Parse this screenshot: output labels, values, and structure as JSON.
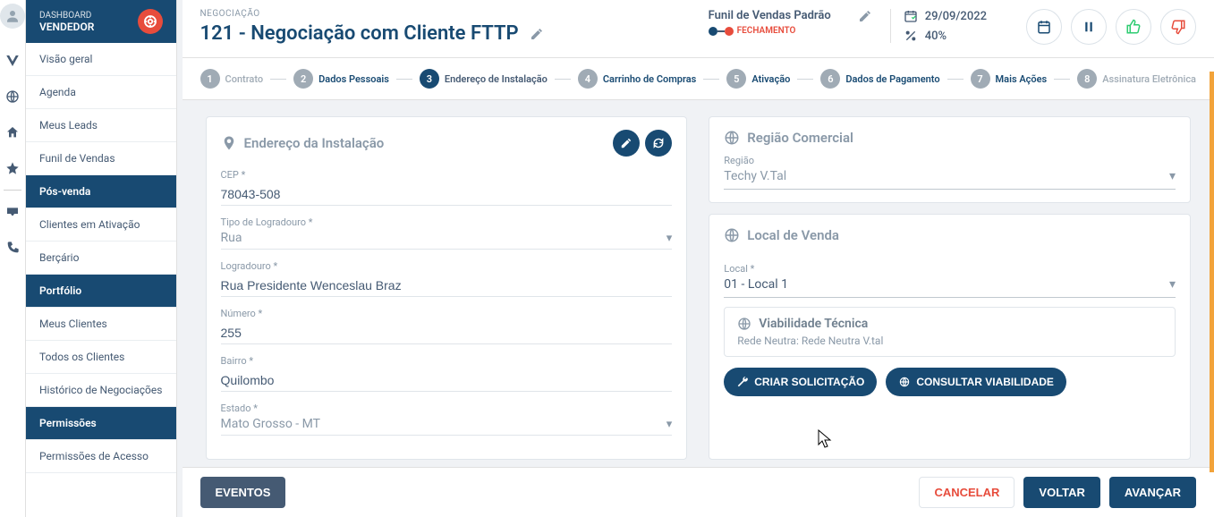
{
  "sidebar": {
    "dashboard_label": "DASHBOARD",
    "role": "VENDEDOR",
    "items": [
      {
        "label": "Visão geral",
        "type": "item"
      },
      {
        "label": "Agenda",
        "type": "item"
      },
      {
        "label": "Meus Leads",
        "type": "item"
      },
      {
        "label": "Funil de Vendas",
        "type": "item"
      },
      {
        "label": "Pós-venda",
        "type": "section"
      },
      {
        "label": "Clientes em Ativação",
        "type": "item"
      },
      {
        "label": "Berçário",
        "type": "item"
      },
      {
        "label": "Portfólio",
        "type": "section"
      },
      {
        "label": "Meus Clientes",
        "type": "item"
      },
      {
        "label": "Todos os Clientes",
        "type": "item"
      },
      {
        "label": "Histórico de Negociações",
        "type": "item"
      },
      {
        "label": "Permissões",
        "type": "section"
      },
      {
        "label": "Permissões de Acesso",
        "type": "item"
      }
    ]
  },
  "header": {
    "breadcrumb": "NEGOCIAÇÃO",
    "title": "121 - Negociação com Cliente FTTP",
    "funnel_title": "Funil de Vendas Padrão",
    "funnel_stage": "FECHAMENTO",
    "date": "29/09/2022",
    "percent": "40%"
  },
  "steps": [
    {
      "num": "1",
      "label": "Contrato",
      "state": "past"
    },
    {
      "num": "2",
      "label": "Dados Pessoais",
      "state": "link"
    },
    {
      "num": "3",
      "label": "Endereço de Instalação",
      "state": "active"
    },
    {
      "num": "4",
      "label": "Carrinho de Compras",
      "state": "link"
    },
    {
      "num": "5",
      "label": "Ativação",
      "state": "link"
    },
    {
      "num": "6",
      "label": "Dados de Pagamento",
      "state": "link"
    },
    {
      "num": "7",
      "label": "Mais Ações",
      "state": "link"
    },
    {
      "num": "8",
      "label": "Assinatura Eletrônica",
      "state": "past"
    }
  ],
  "install": {
    "card_title": "Endereço da Instalação",
    "fields": {
      "cep_label": "CEP *",
      "cep_value": "78043-508",
      "tipo_label": "Tipo de Logradouro *",
      "tipo_value": "Rua",
      "logradouro_label": "Logradouro *",
      "logradouro_value": "Rua Presidente Wenceslau Braz",
      "numero_label": "Número *",
      "numero_value": "255",
      "bairro_label": "Bairro *",
      "bairro_value": "Quilombo",
      "estado_label": "Estado *",
      "estado_value": "Mato Grosso - MT"
    }
  },
  "right": {
    "regiao_title": "Região Comercial",
    "regiao_label": "Região",
    "regiao_value": "Techy V.Tal",
    "local_title": "Local de Venda",
    "local_label": "Local *",
    "local_value": "01 - Local 1",
    "viability_title": "Viabilidade Técnica",
    "viability_sub": "Rede Neutra: Rede Neutra V.tal",
    "btn_criar": "CRIAR SOLICITAÇÃO",
    "btn_consultar": "CONSULTAR VIABILIDADE"
  },
  "footer": {
    "eventos": "EVENTOS",
    "cancelar": "CANCELAR",
    "voltar": "VOLTAR",
    "avancar": "AVANÇAR"
  }
}
